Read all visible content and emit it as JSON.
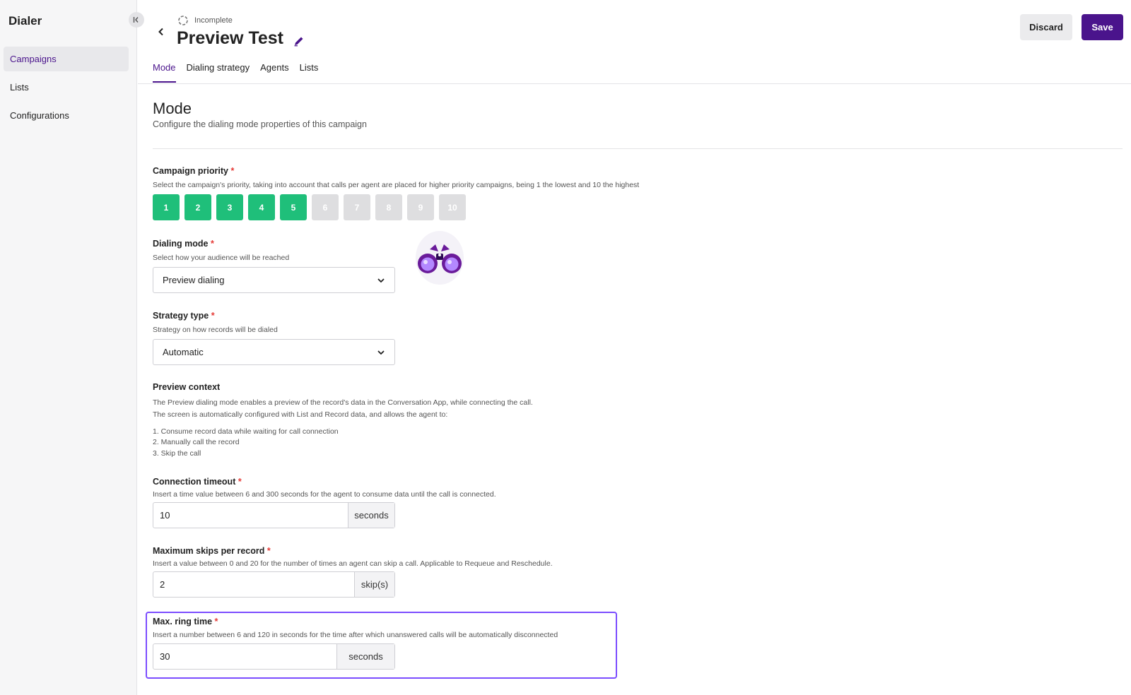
{
  "sidebar": {
    "title": "Dialer",
    "items": [
      {
        "label": "Campaigns"
      },
      {
        "label": "Lists"
      },
      {
        "label": "Configurations"
      }
    ]
  },
  "header": {
    "status": "Incomplete",
    "title": "Preview Test",
    "discard_label": "Discard",
    "save_label": "Save"
  },
  "tabs": [
    {
      "label": "Mode"
    },
    {
      "label": "Dialing strategy"
    },
    {
      "label": "Agents"
    },
    {
      "label": "Lists"
    }
  ],
  "section": {
    "title": "Mode",
    "description": "Configure the dialing mode properties of this campaign"
  },
  "priority": {
    "label": "Campaign priority",
    "required": "*",
    "help": "Select the campaign's priority, taking into account that calls per agent are placed for higher priority campaigns, being 1 the lowest and 10 the highest",
    "options": [
      "1",
      "2",
      "3",
      "4",
      "5",
      "6",
      "7",
      "8",
      "9",
      "10"
    ],
    "selected": 5
  },
  "dialing_mode": {
    "label": "Dialing mode",
    "required": "*",
    "help": "Select how your audience will be reached",
    "value": "Preview dialing"
  },
  "strategy_type": {
    "label": "Strategy type",
    "required": "*",
    "help": "Strategy on how records will be dialed",
    "value": "Automatic"
  },
  "preview_context": {
    "label": "Preview context",
    "line1": "The Preview dialing mode enables a preview of the record's data in the Conversation App, while connecting the call.",
    "line2": "The screen is automatically configured with List and Record data, and allows the agent to:",
    "items": [
      "1. Consume record data while waiting for call connection",
      "2. Manually call the record",
      "3. Skip the call"
    ]
  },
  "connection_timeout": {
    "label": "Connection timeout",
    "required": "*",
    "help": "Insert a time value between 6 and 300 seconds for the agent to consume data until the call is connected.",
    "value": "10",
    "unit": "seconds"
  },
  "max_skips": {
    "label": "Maximum skips per record",
    "required": "*",
    "help": "Insert a value between 0 and 20 for the number of times an agent can skip a call. Applicable to Requeue and Reschedule.",
    "value": "2",
    "unit": "skip(s)"
  },
  "max_ring_time": {
    "label": "Max. ring time",
    "required": "*",
    "help": "Insert a number between 6 and 120 in seconds for the time after which unanswered calls will be automatically disconnected",
    "value": "30",
    "unit": "seconds"
  },
  "colors": {
    "accent": "#4a148c",
    "priority_on": "#1fbf7a",
    "priority_off": "#dedee0",
    "required": "#e53935",
    "highlight": "#7c4dff"
  }
}
